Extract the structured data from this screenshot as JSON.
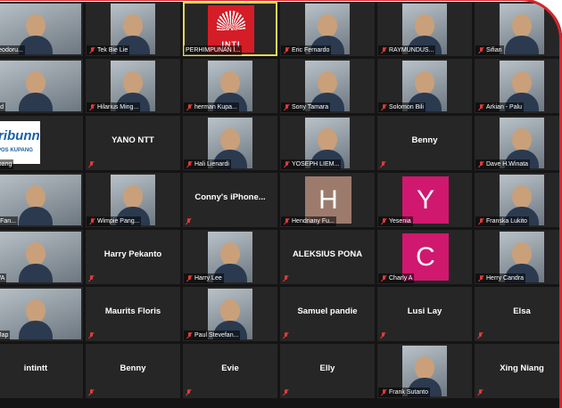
{
  "meeting": {
    "accent_color": "#d8242c",
    "active_speaker_border": "#e6d75a",
    "tiles": [
      {
        "kind": "video",
        "label": "Theodoru...",
        "muted": false
      },
      {
        "kind": "video",
        "label": "Tek Bie Lie",
        "muted": true
      },
      {
        "kind": "logo",
        "label": "PERHIMPUNAN I...",
        "logo_text": "INTI",
        "muted": false,
        "active": true
      },
      {
        "kind": "video",
        "label": "Eric Fernardo",
        "muted": true
      },
      {
        "kind": "video",
        "label": "RAYMUNDUS...",
        "muted": true
      },
      {
        "kind": "video",
        "label": "Sifian",
        "muted": true
      },
      {
        "kind": "video",
        "label": "iPad",
        "muted": false
      },
      {
        "kind": "video",
        "label": "Hilarius Ming...",
        "muted": true
      },
      {
        "kind": "video",
        "label": "herman Kupa...",
        "muted": true
      },
      {
        "kind": "video",
        "label": "Sony Tamara",
        "muted": true
      },
      {
        "kind": "video",
        "label": "Solomon Bili",
        "muted": true
      },
      {
        "kind": "video",
        "label": "Arkian - Palu",
        "muted": true
      },
      {
        "kind": "tribun",
        "label": "Lupang",
        "tribun_text": "tribunn",
        "tribun_sub": "POS KUPANG",
        "muted": false
      },
      {
        "kind": "name",
        "name": "YANO NTT",
        "muted": true
      },
      {
        "kind": "video",
        "label": "Hali Lienardi",
        "muted": true
      },
      {
        "kind": "video",
        "label": "YOSEPH LIEM...",
        "muted": true
      },
      {
        "kind": "name",
        "name": "Benny",
        "muted": true
      },
      {
        "kind": "video",
        "label": "Dave H.Winata",
        "muted": true
      },
      {
        "kind": "video",
        "label": "W. Fan...",
        "muted": false
      },
      {
        "kind": "video",
        "label": "Wimpie Pang...",
        "muted": true
      },
      {
        "kind": "name",
        "name": "Conny's iPhone...",
        "muted": true
      },
      {
        "kind": "avatar",
        "letter": "H",
        "avatar_color": "#9c7b6d",
        "label": "Hendriany Fu...",
        "muted": true
      },
      {
        "kind": "avatar",
        "letter": "Y",
        "avatar_color": "#d0186f",
        "label": "Yesenia",
        "muted": true
      },
      {
        "kind": "video",
        "label": "Franska Lukito",
        "muted": true
      },
      {
        "kind": "video",
        "label": "AWA",
        "muted": false
      },
      {
        "kind": "name",
        "name": "Harry Pekanto",
        "muted": true
      },
      {
        "kind": "video",
        "label": "Harry Lee",
        "muted": true
      },
      {
        "kind": "name",
        "name": "ALEKSIUS PONA",
        "muted": true
      },
      {
        "kind": "avatar",
        "letter": "C",
        "avatar_color": "#d0186f",
        "label": "Charly A",
        "muted": true
      },
      {
        "kind": "video",
        "label": "Herry Candra",
        "muted": true
      },
      {
        "kind": "video",
        "label": "ra Jap",
        "muted": false
      },
      {
        "kind": "name",
        "name": "Maurits Floris",
        "muted": true
      },
      {
        "kind": "video",
        "label": "Paul Stevefan...",
        "muted": true
      },
      {
        "kind": "name",
        "name": "Samuel pandie",
        "muted": true
      },
      {
        "kind": "name",
        "name": "Lusi Lay",
        "muted": true
      },
      {
        "kind": "name",
        "name": "Elsa",
        "muted": true
      },
      {
        "kind": "name",
        "name": "intintt",
        "muted": true
      },
      {
        "kind": "name",
        "name": "Benny",
        "muted": true
      },
      {
        "kind": "name",
        "name": "Evie",
        "muted": true
      },
      {
        "kind": "name",
        "name": "Elly",
        "muted": true
      },
      {
        "kind": "video",
        "label": "Frank Sutanto",
        "muted": true
      },
      {
        "kind": "name",
        "name": "Xing Niang",
        "muted": true
      }
    ]
  }
}
